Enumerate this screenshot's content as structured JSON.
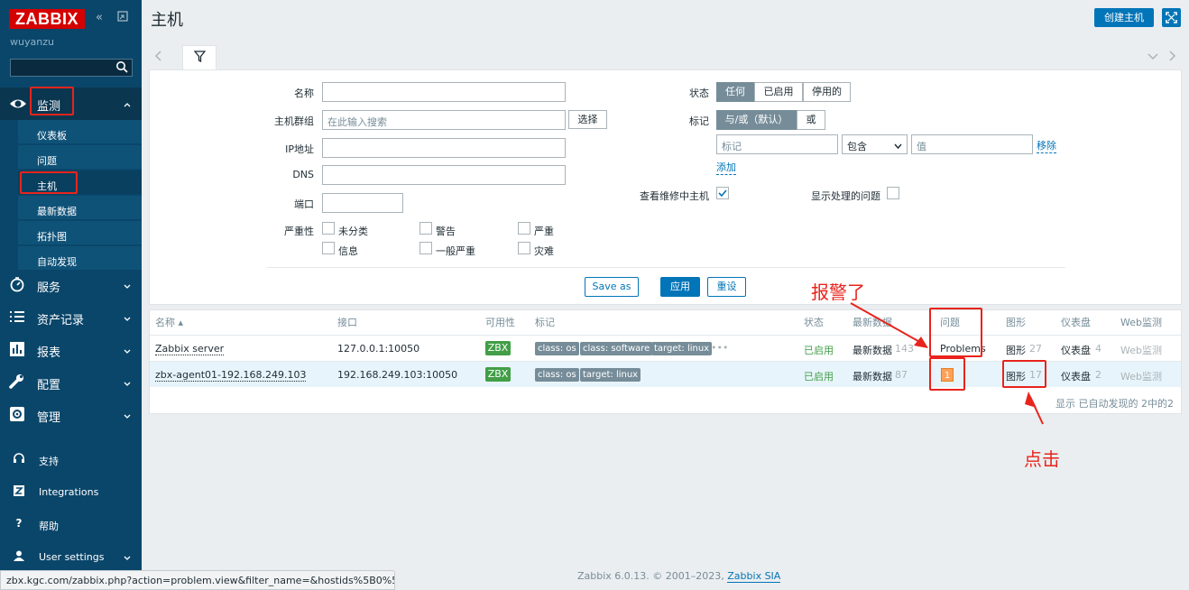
{
  "sidebar": {
    "logo": "ZABBIX",
    "user": "wuyanzu",
    "search_placeholder": "",
    "menu": [
      {
        "label": "监测",
        "icon": "eye-icon",
        "expanded": true
      },
      {
        "label": "服务",
        "icon": "clock-icon"
      },
      {
        "label": "资产记录",
        "icon": "list-icon"
      },
      {
        "label": "报表",
        "icon": "bar-chart-icon"
      },
      {
        "label": "配置",
        "icon": "wrench-icon"
      },
      {
        "label": "管理",
        "icon": "gear-icon"
      }
    ],
    "submenu": [
      "仪表板",
      "问题",
      "主机",
      "最新数据",
      "拓扑图",
      "自动发现"
    ],
    "bottom": [
      {
        "label": "支持",
        "icon": "headset-icon"
      },
      {
        "label": "Integrations",
        "icon": "z-icon"
      },
      {
        "label": "帮助",
        "icon": "help-icon"
      },
      {
        "label": "User settings",
        "icon": "user-icon"
      }
    ]
  },
  "header": {
    "title": "主机",
    "create_button": "创建主机"
  },
  "filter": {
    "name_label": "名称",
    "group_label": "主机群组",
    "group_placeholder": "在此输入搜索",
    "select_button": "选择",
    "ip_label": "IP地址",
    "dns_label": "DNS",
    "port_label": "端口",
    "severity_label": "严重性",
    "severities": [
      "未分类",
      "警告",
      "严重",
      "信息",
      "一般严重",
      "灾难"
    ],
    "status_label": "状态",
    "status_options": [
      "任何",
      "已启用",
      "停用的"
    ],
    "tags_label": "标记",
    "tag_ops": [
      "与/或（默认）",
      "或"
    ],
    "tag_placeholder": "标记",
    "tag_operator": "包含",
    "value_placeholder": "值",
    "remove_link": "移除",
    "add_link": "添加",
    "maintenance_label": "查看维修中主机",
    "suppressed_label": "显示处理的问题",
    "save_as": "Save as",
    "apply": "应用",
    "reset": "重设"
  },
  "table": {
    "headers": [
      "名称 ▴",
      "接口",
      "可用性",
      "标记",
      "状态",
      "最新数据",
      "问题",
      "图形",
      "仪表盘",
      "Web监测"
    ],
    "rows": [
      {
        "name": "Zabbix server",
        "interface": "127.0.0.1:10050",
        "availability": "ZBX",
        "tags": [
          "class: os",
          "class: software",
          "target: linux"
        ],
        "more": "•••",
        "status": "已启用",
        "latest_link": "最新数据",
        "latest_count": "143",
        "problems": "Problems",
        "graphs_link": "图形",
        "graphs_count": "27",
        "dash_link": "仪表盘",
        "dash_count": "4",
        "web": "Web监测"
      },
      {
        "name": "zbx-agent01-192.168.249.103",
        "interface": "192.168.249.103:10050",
        "availability": "ZBX",
        "tags": [
          "class: os",
          "target: linux"
        ],
        "status": "已启用",
        "latest_link": "最新数据",
        "latest_count": "87",
        "problems": "1",
        "graphs_link": "图形",
        "graphs_count": "17",
        "dash_link": "仪表盘",
        "dash_count": "2",
        "web": "Web监测"
      }
    ],
    "footnote": "显示 已自动发现的 2中的2"
  },
  "annotations": {
    "alarm": "报警了",
    "click": "点击"
  },
  "statusbar": "zbx.kgc.com/zabbix.php?action=problem.view&filter_name=&hostids%5B0%5...",
  "footer": {
    "text": "Zabbix 6.0.13. © 2001–2023,",
    "link": "Zabbix SIA"
  },
  "colors": {
    "sidebar": "#0a466a",
    "primary": "#0275b8",
    "annotation": "#e8241c",
    "enabled": "#429e47",
    "problem": "#ffa059"
  }
}
